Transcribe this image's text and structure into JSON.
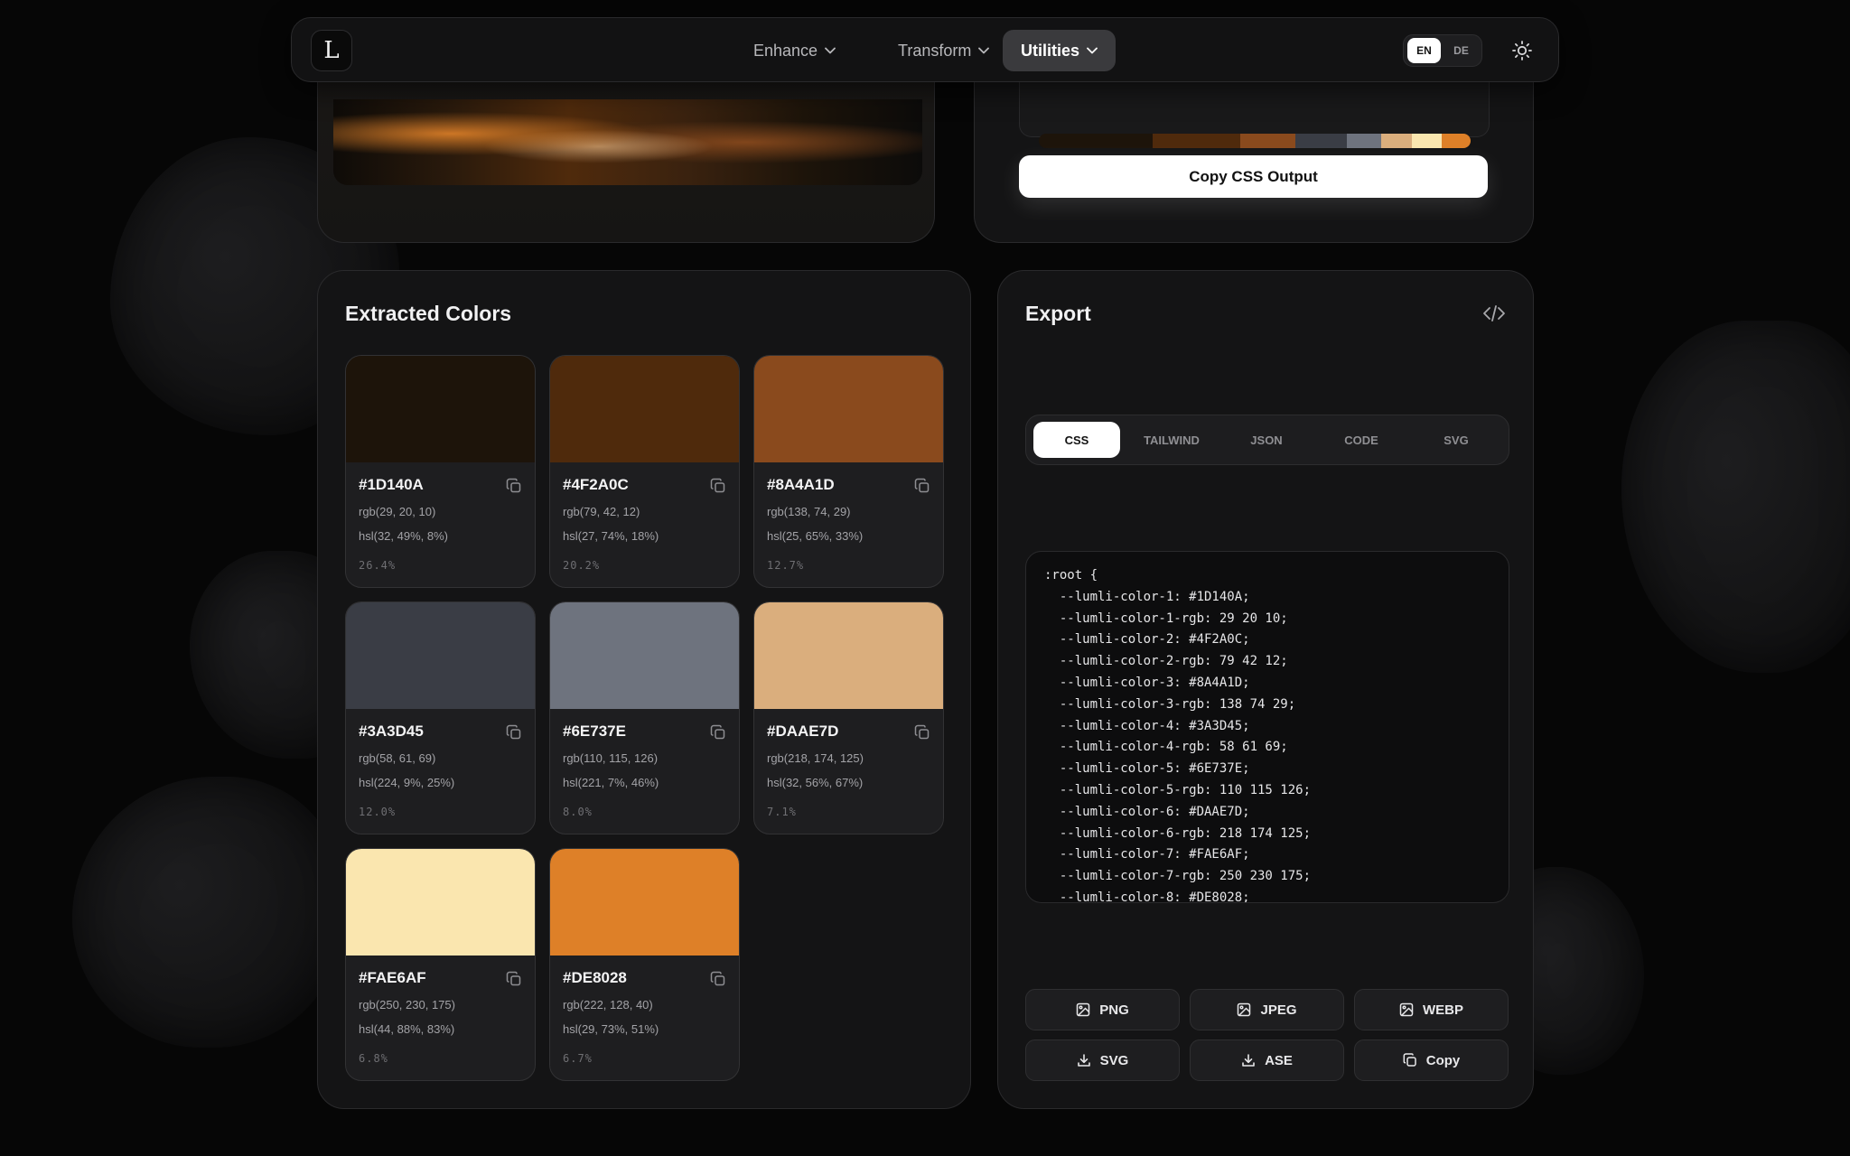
{
  "nav": {
    "logo": "L",
    "items": [
      {
        "label": "Enhance"
      },
      {
        "label": "Transform"
      },
      {
        "label": "Utilities"
      }
    ],
    "languages": [
      "EN",
      "DE"
    ]
  },
  "palette_bar": {
    "colors": [
      "#1D140A",
      "#4F2A0C",
      "#8A4A1D",
      "#3A3D45",
      "#6E737E",
      "#DAAE7D",
      "#FAE6AF",
      "#DE8028"
    ],
    "shares": [
      26.4,
      20.2,
      12.7,
      12.0,
      8.0,
      7.1,
      6.8,
      6.7
    ]
  },
  "copy_css_label": "Copy CSS Output",
  "extracted": {
    "title": "Extracted Colors",
    "swatches": [
      {
        "hex": "#1D140A",
        "rgb": "rgb(29, 20, 10)",
        "hsl": "hsl(32, 49%, 8%)",
        "pct": "26.4%"
      },
      {
        "hex": "#4F2A0C",
        "rgb": "rgb(79, 42, 12)",
        "hsl": "hsl(27, 74%, 18%)",
        "pct": "20.2%"
      },
      {
        "hex": "#8A4A1D",
        "rgb": "rgb(138, 74, 29)",
        "hsl": "hsl(25, 65%, 33%)",
        "pct": "12.7%"
      },
      {
        "hex": "#3A3D45",
        "rgb": "rgb(58, 61, 69)",
        "hsl": "hsl(224, 9%, 25%)",
        "pct": "12.0%"
      },
      {
        "hex": "#6E737E",
        "rgb": "rgb(110, 115, 126)",
        "hsl": "hsl(221, 7%, 46%)",
        "pct": "8.0%"
      },
      {
        "hex": "#DAAE7D",
        "rgb": "rgb(218, 174, 125)",
        "hsl": "hsl(32, 56%, 67%)",
        "pct": "7.1%"
      },
      {
        "hex": "#FAE6AF",
        "rgb": "rgb(250, 230, 175)",
        "hsl": "hsl(44, 88%, 83%)",
        "pct": "6.8%"
      },
      {
        "hex": "#DE8028",
        "rgb": "rgb(222, 128, 40)",
        "hsl": "hsl(29, 73%, 51%)",
        "pct": "6.7%"
      }
    ]
  },
  "export": {
    "title": "Export",
    "tabs": [
      "CSS",
      "TAILWIND",
      "JSON",
      "CODE",
      "SVG"
    ],
    "active_tab": "CSS",
    "code_lines": [
      ":root {",
      "  --lumli-color-1: #1D140A;",
      "  --lumli-color-1-rgb: 29 20 10;",
      "  --lumli-color-2: #4F2A0C;",
      "  --lumli-color-2-rgb: 79 42 12;",
      "  --lumli-color-3: #8A4A1D;",
      "  --lumli-color-3-rgb: 138 74 29;",
      "  --lumli-color-4: #3A3D45;",
      "  --lumli-color-4-rgb: 58 61 69;",
      "  --lumli-color-5: #6E737E;",
      "  --lumli-color-5-rgb: 110 115 126;",
      "  --lumli-color-6: #DAAE7D;",
      "  --lumli-color-6-rgb: 218 174 125;",
      "  --lumli-color-7: #FAE6AF;",
      "  --lumli-color-7-rgb: 250 230 175;",
      "  --lumli-color-8: #DE8028;"
    ],
    "buttons": [
      {
        "label": "PNG",
        "icon": "image-icon"
      },
      {
        "label": "JPEG",
        "icon": "image-icon"
      },
      {
        "label": "WEBP",
        "icon": "image-icon"
      },
      {
        "label": "SVG",
        "icon": "download-icon"
      },
      {
        "label": "ASE",
        "icon": "download-icon"
      },
      {
        "label": "Copy",
        "icon": "copy-icon"
      }
    ]
  }
}
